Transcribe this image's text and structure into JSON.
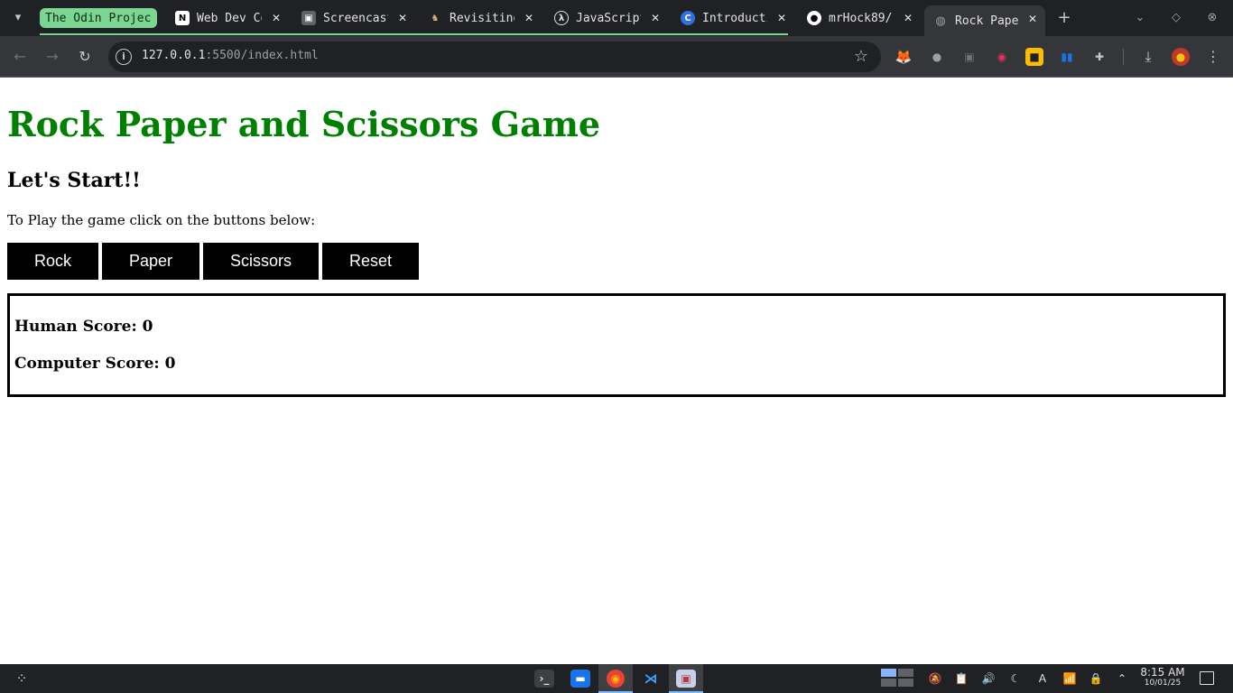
{
  "browser": {
    "tabs": [
      {
        "title": "The Odin Project",
        "favicon": "odin-group-chip",
        "grouped": true,
        "active": false
      },
      {
        "title": "Web Dev Course",
        "favicon": "notion-icon",
        "active": false
      },
      {
        "title": "Screencast",
        "favicon": "screencast-icon",
        "active": false
      },
      {
        "title": "Revisiting",
        "favicon": "deer-icon",
        "active": false
      },
      {
        "title": "JavaScript",
        "favicon": "lambda-icon",
        "active": false
      },
      {
        "title": "Introduction",
        "favicon": "c-icon",
        "active": false
      },
      {
        "title": "mrHock89/",
        "favicon": "github-icon",
        "active": false
      },
      {
        "title": "Rock Paper",
        "favicon": "globe-icon",
        "active": true
      }
    ],
    "address": {
      "host": "127.0.0.1",
      "rest": ":5500/index.html"
    },
    "group_color": "#7bd691"
  },
  "page": {
    "title": "Rock Paper and Scissors Game",
    "title_color": "#008000",
    "subtitle": "Let's Start!!",
    "instructions": "To Play the game click on the buttons below:",
    "buttons": {
      "rock": "Rock",
      "paper": "Paper",
      "scissors": "Scissors",
      "reset": "Reset"
    },
    "scores": {
      "human": "Human Score: 0",
      "computer": "Computer Score: 0"
    }
  },
  "taskbar": {
    "clock_time": "8:15 AM",
    "clock_date": "10/01/25"
  }
}
